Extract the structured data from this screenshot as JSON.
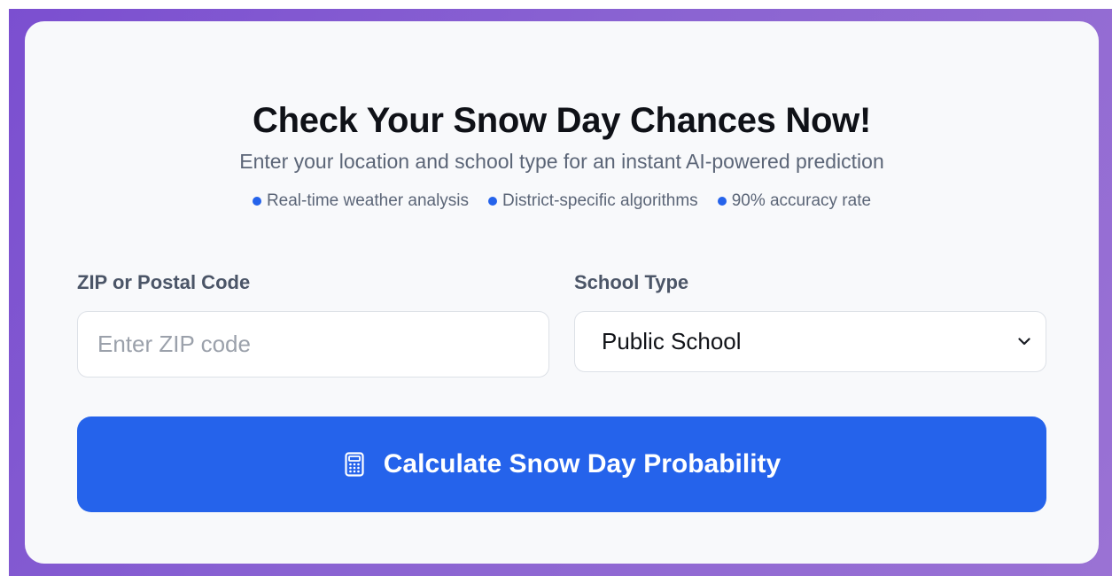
{
  "heading": {
    "title": "Check Your Snow Day Chances Now!",
    "subtitle": "Enter your location and school type for an instant AI-powered prediction"
  },
  "features": [
    {
      "label": "Real-time weather analysis"
    },
    {
      "label": "District-specific algorithms"
    },
    {
      "label": "90% accuracy rate"
    }
  ],
  "form": {
    "zip_label": "ZIP or Postal Code",
    "zip_value": "",
    "zip_placeholder": "Enter ZIP code",
    "school_label": "School Type",
    "school_selected": "Public School",
    "school_icon": "chevron-down-icon"
  },
  "cta": {
    "label": "Calculate Snow Day Probability",
    "icon": "calculator-icon"
  },
  "colors": {
    "accent": "#2563eb",
    "backdrop_start": "#7b4fd0",
    "backdrop_end": "#9a72d4",
    "card": "#f8f9fb",
    "muted_text": "#5b6577"
  }
}
